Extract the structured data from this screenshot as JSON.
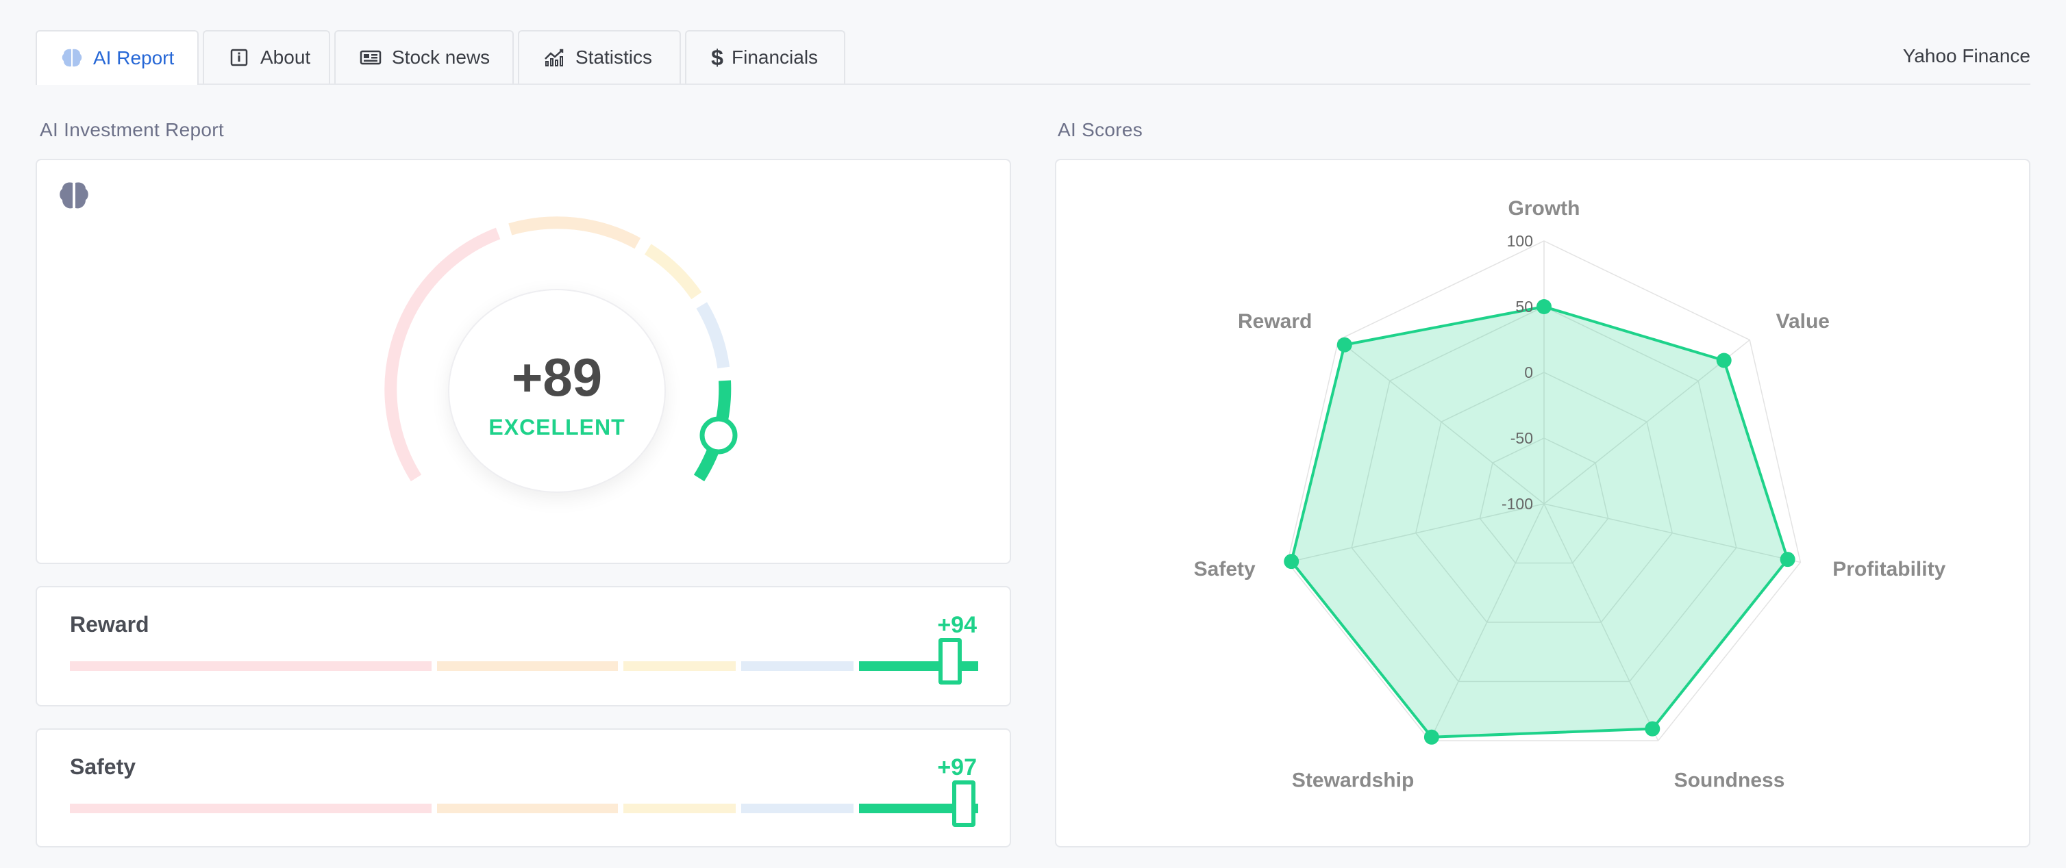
{
  "tabs": [
    {
      "label": "AI Report",
      "icon": "brain-icon",
      "active": true
    },
    {
      "label": "About",
      "icon": "info-icon",
      "active": false
    },
    {
      "label": "Stock news",
      "icon": "newspaper-icon",
      "active": false
    },
    {
      "label": "Statistics",
      "icon": "chart-icon",
      "active": false
    },
    {
      "label": "Financials",
      "icon": "dollar-icon",
      "active": false
    }
  ],
  "brand": "Yahoo Finance",
  "report": {
    "title": "AI Investment Report",
    "score": "+89",
    "rating": "EXCELLENT",
    "score_value": 89
  },
  "metrics": [
    {
      "name": "Reward",
      "value": "+94",
      "score": 94
    },
    {
      "name": "Safety",
      "value": "+97",
      "score": 97
    }
  ],
  "scores": {
    "title": "AI Scores"
  },
  "colors": {
    "accent_green": "#1ed28a",
    "active_tab": "#2667d6",
    "pink": "#fde1e4",
    "orange": "#fdebd5",
    "yellow": "#fdf3d5",
    "blue": "#e2ecf8"
  },
  "chart_data": {
    "type": "radar",
    "categories": [
      "Growth",
      "Value",
      "Profitability",
      "Soundness",
      "Stewardship",
      "Safety",
      "Reward"
    ],
    "series": [
      {
        "values": [
          50,
          75,
          90,
          90,
          97,
          97,
          94
        ]
      }
    ],
    "ticks": [
      "100",
      "50",
      "0",
      "-50",
      "-100"
    ],
    "range": [
      -100,
      100
    ]
  }
}
